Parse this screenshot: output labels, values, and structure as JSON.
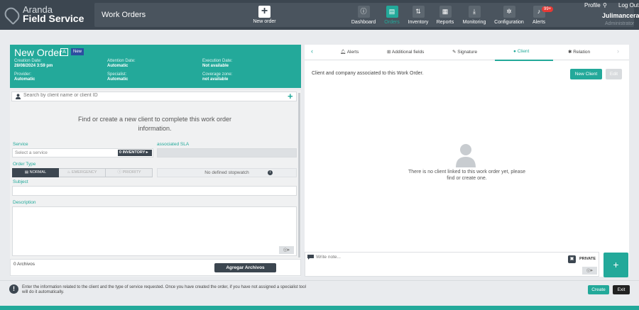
{
  "app": {
    "name_line1": "Aranda",
    "name_line2": "Field Service",
    "module_title": "Work Orders"
  },
  "topnav": {
    "new_order": "New order",
    "items": [
      {
        "label": "Dashboard",
        "icon": "dashboard-icon"
      },
      {
        "label": "Orders",
        "icon": "orders-icon"
      },
      {
        "label": "Inventory",
        "icon": "inventory-icon"
      },
      {
        "label": "Reports",
        "icon": "reports-icon"
      },
      {
        "label": "Monitoring",
        "icon": "monitoring-icon"
      },
      {
        "label": "Configuration",
        "icon": "gear-icon"
      },
      {
        "label": "Alerts",
        "icon": "bell-icon"
      }
    ],
    "alerts_badge": "99+"
  },
  "user": {
    "profile": "Profile",
    "logout": "Log Out",
    "name": "Julimancera",
    "role": "Administrator"
  },
  "order": {
    "title": "New Order",
    "type_badge": "A",
    "status_badge": "New",
    "fields": [
      {
        "label": "Creation Date:",
        "value": "28/08/2024 3:59 pm"
      },
      {
        "label": "Attention Date:",
        "value": "Automatic"
      },
      {
        "label": "Execution Date:",
        "value": "Not available"
      },
      {
        "label": "Provider:",
        "value": "Automatic"
      },
      {
        "label": "Specialist:",
        "value": "Automatic"
      },
      {
        "label": "Coverage zone:",
        "value": "not available"
      }
    ]
  },
  "client_search": {
    "placeholder": "Search by client name or client ID"
  },
  "find_client_msg": "Find or create a new client to complete this work order information.",
  "service": {
    "label": "Service",
    "placeholder": "Select a service",
    "inventory_btn": "0 INVENTORY"
  },
  "sla": {
    "label": "associated SLA"
  },
  "order_type": {
    "label": "Order Type",
    "options": [
      "NORMAL",
      "EMERGENCY",
      "PRIORITY"
    ],
    "selected": "NORMAL"
  },
  "stopwatch": "No defined stopwatch",
  "subject": {
    "label": "Subject"
  },
  "description": {
    "label": "Description"
  },
  "files": {
    "count": "0 Archivos",
    "add_button": "Agregar Archivos"
  },
  "tabs": [
    {
      "label": "Alerts",
      "icon": "bell-icon"
    },
    {
      "label": "Additional fields",
      "icon": "plus-square-icon"
    },
    {
      "label": "Signature",
      "icon": "pen-icon"
    },
    {
      "label": "Client",
      "icon": "user-icon"
    },
    {
      "label": "Relation",
      "icon": "relation-icon"
    }
  ],
  "active_tab": "Client",
  "client_panel": {
    "description": "Client and company associated to this Work Order.",
    "new_client_btn": "New Client",
    "edit_btn": "Edit",
    "empty_msg": "There is no client linked to this work order yet, please find or create one."
  },
  "note": {
    "placeholder": "Write note...",
    "private_label": "PRIVATE",
    "send_symbol": "+"
  },
  "footer": {
    "info": "Enter the information related to the client and the type of service requested. Once you have created the order, if you have not assigned a specialist tool will do it automatically.",
    "create_btn": "Create",
    "exit_btn": "Exit"
  },
  "colors": {
    "accent": "#23a99a",
    "topbar": "#3c4650",
    "badge_blue": "#2c4ea0",
    "alert_red": "#e53935"
  }
}
